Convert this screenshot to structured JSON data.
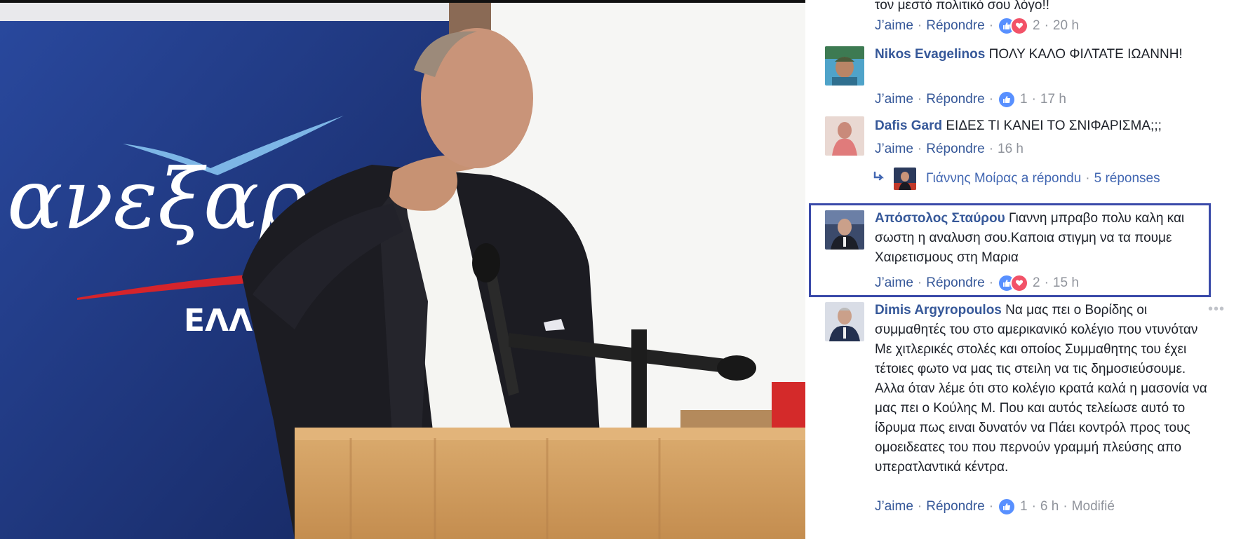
{
  "photo": {
    "banner_text": "ανεξαρ",
    "banner_subtext": "ΕΛΛΗΝ"
  },
  "comments": [
    {
      "author": "",
      "text": "τον μεστό πολιτικό σου λόγο!!",
      "like_label": "J’aime",
      "reply_label": "Répondre",
      "reactions": [
        "like",
        "love"
      ],
      "reaction_count": "2",
      "time": "20 h"
    },
    {
      "author": "Nikos Evagelinos",
      "text": "ΠΟΛΥ ΚΑΛΟ ΦΙΛΤΑΤΕ ΙΩΑΝΝΗ!",
      "like_label": "J’aime",
      "reply_label": "Répondre",
      "reactions": [
        "like"
      ],
      "reaction_count": "1",
      "time": "17 h"
    },
    {
      "author": "Dafis Gard",
      "text": "ΕΙΔΕΣ ΤΙ ΚΑΝΕΙ ΤΟ ΣΝΙΦΑΡΙΣΜΑ;;;",
      "like_label": "J’aime",
      "reply_label": "Répondre",
      "time": "16 h",
      "replies": {
        "replier": "Γιάννης Μοίρας a répondu",
        "count_label": "5 réponses"
      }
    },
    {
      "author": "Απόστολος Σταύρου",
      "text": "Γιαννη μπραβο πολυ καλη και σωστη η αναλυση σου.Καποια στιγμη να τα πουμε Χαιρετισμους στη Μαρια",
      "like_label": "J’aime",
      "reply_label": "Répondre",
      "reactions": [
        "like",
        "love"
      ],
      "reaction_count": "2",
      "time": "15 h",
      "highlighted": true
    },
    {
      "author": "Dimis Argyropoulos",
      "text": "Να μας πει ο Βορίδης οι συμμαθητές του στο αμερικανικό κολέγιο που ντυνόταν Με χιτλερικές στολές και οποίος Συμμαθητης του έχει τέτοιες φωτο να μας τις στειλη να τις δημοσιεύσουμε. Αλλα όταν λέμε ότι στο κολέγιο κρατά καλά η μασονία να μας πει ο Κούλης Μ. Που και αυτός τελείωσε αυτό το ίδρυμα πως ειναι δυνατόν να Πάει κοντρόλ προς τους ομοειδεατες του που περνούν γραμμή πλεύσης απο υπερατλαντικά κέντρα.",
      "like_label": "J’aime",
      "reply_label": "Répondre",
      "reactions": [
        "like"
      ],
      "reaction_count": "1",
      "time": "6 h",
      "edited_label": "Modifié"
    }
  ],
  "more_options": "•••",
  "colors": {
    "link": "#365899",
    "highlight_border": "#3a4aa9",
    "like": "#5890ff",
    "love": "#f25268"
  }
}
